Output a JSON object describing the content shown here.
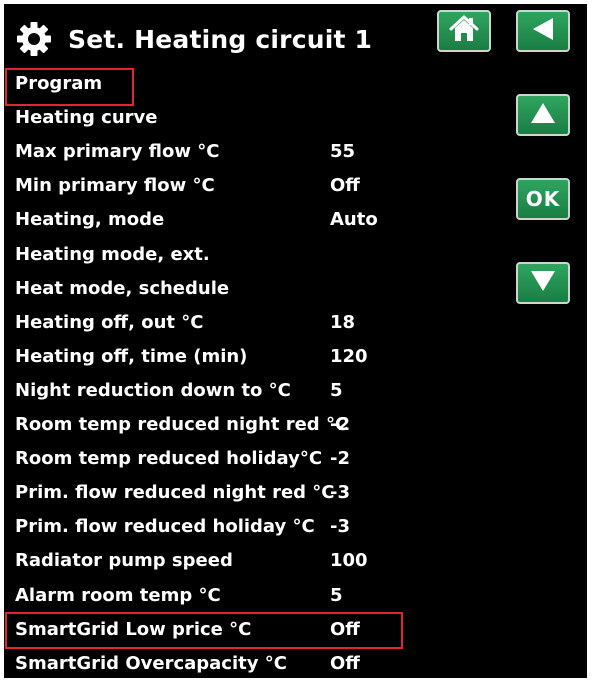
{
  "header": {
    "title": "Set. Heating circuit 1",
    "settings_icon": "gear-icon",
    "home_icon": "home-icon",
    "back_icon": "back-arrow-icon"
  },
  "side_buttons": {
    "up_icon": "up-arrow-icon",
    "ok_label": "OK",
    "down_icon": "down-arrow-icon"
  },
  "settings": [
    {
      "label": "Program",
      "value": ""
    },
    {
      "label": "Heating curve",
      "value": ""
    },
    {
      "label": "Max primary flow °C",
      "value": "55"
    },
    {
      "label": "Min primary flow °C",
      "value": "Off"
    },
    {
      "label": "Heating, mode",
      "value": "Auto"
    },
    {
      "label": "Heating mode, ext.",
      "value": ""
    },
    {
      "label": "Heat mode, schedule",
      "value": ""
    },
    {
      "label": "Heating off, out °C",
      "value": "18"
    },
    {
      "label": "Heating off, time (min)",
      "value": "120"
    },
    {
      "label": "Night reduction down to °C",
      "value": "5"
    },
    {
      "label": "Room temp reduced night red °C",
      "value": "-2"
    },
    {
      "label": "Room temp reduced holiday°C",
      "value": "-2"
    },
    {
      "label": "Prim. flow reduced night red °C",
      "value": "-3"
    },
    {
      "label": "Prim. flow reduced holiday °C",
      "value": "-3"
    },
    {
      "label": "Radiator pump speed",
      "value": "100"
    },
    {
      "label": "Alarm room temp °C",
      "value": "5"
    },
    {
      "label": "SmartGrid Low price °C",
      "value": "Off"
    },
    {
      "label": "SmartGrid Overcapacity °C",
      "value": "Off"
    }
  ],
  "highlighted_items": [
    "Program",
    "SmartGrid Low price °C"
  ],
  "colors": {
    "screen_background": "#000000",
    "text": "#ffffff",
    "button_green": "#1f8a4c",
    "button_border": "#c9d8cf",
    "highlight_red": "#e0272f"
  }
}
